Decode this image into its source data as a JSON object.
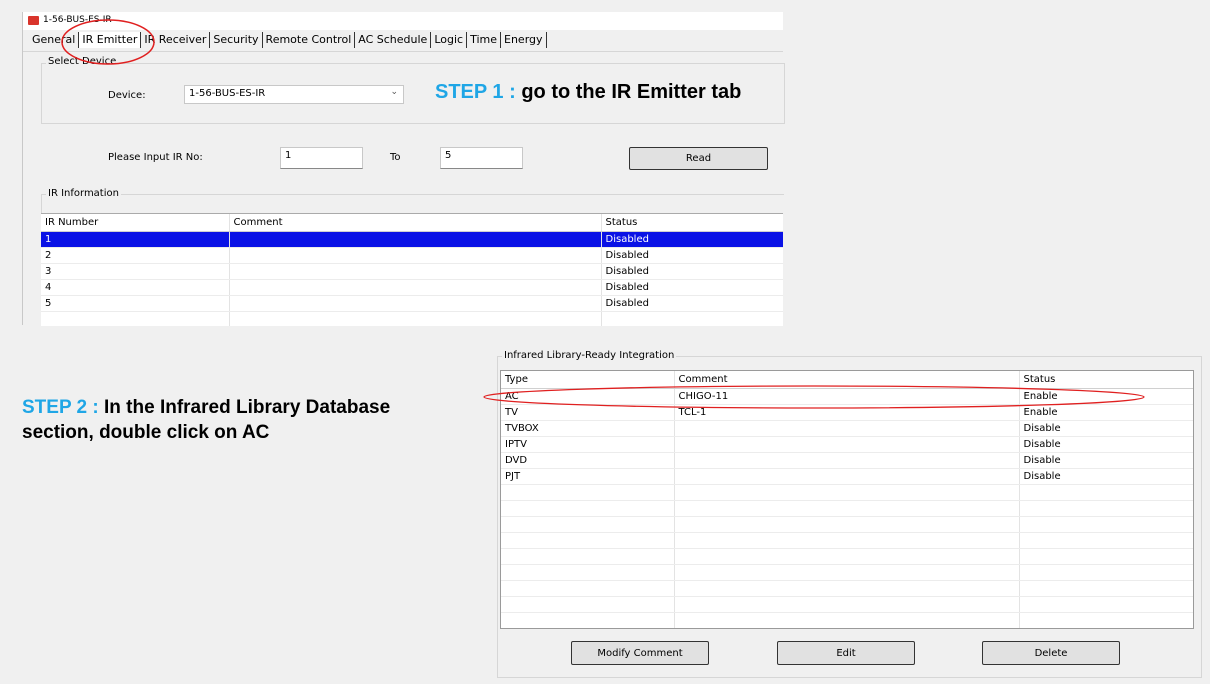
{
  "window": {
    "title": "1-56-BUS-ES-IR",
    "tabs": [
      "General",
      "IR Emitter",
      "IR Receiver",
      "Security",
      "Remote Control",
      "AC Schedule",
      "Logic",
      "Time",
      "Energy"
    ],
    "active_tab": "IR Emitter"
  },
  "select_device": {
    "group_label": "Select Device",
    "device_label": "Device:",
    "device_value": "1-56-BUS-ES-IR"
  },
  "ir_input": {
    "label": "Please Input IR No:",
    "from_value": "1",
    "to_label": "To",
    "to_value": "5",
    "read_button": "Read"
  },
  "ir_information": {
    "group_label": "IR Information",
    "columns": [
      "IR Number",
      "Comment",
      "Status"
    ],
    "rows": [
      {
        "number": "1",
        "comment": "",
        "status": "Disabled"
      },
      {
        "number": "2",
        "comment": "",
        "status": "Disabled"
      },
      {
        "number": "3",
        "comment": "",
        "status": "Disabled"
      },
      {
        "number": "4",
        "comment": "",
        "status": "Disabled"
      },
      {
        "number": "5",
        "comment": "",
        "status": "Disabled"
      }
    ]
  },
  "step1": {
    "prefix": "STEP 1 :",
    "text": " go to the IR Emitter tab"
  },
  "step2": {
    "prefix": "STEP 2 :",
    "text_line1": " In the Infrared Library Database",
    "text_line2": "section, double click on AC"
  },
  "library": {
    "group_label": "Infrared Library-Ready Integration",
    "columns": [
      "Type",
      "Comment",
      "Status"
    ],
    "rows": [
      {
        "type": "AC",
        "comment": "CHIGO-11",
        "status": "Enable"
      },
      {
        "type": "TV",
        "comment": "TCL-1",
        "status": "Enable"
      },
      {
        "type": "TVBOX",
        "comment": "",
        "status": "Disable"
      },
      {
        "type": "IPTV",
        "comment": "",
        "status": "Disable"
      },
      {
        "type": "DVD",
        "comment": "",
        "status": "Disable"
      },
      {
        "type": "PJT",
        "comment": "",
        "status": "Disable"
      }
    ],
    "buttons": {
      "modify": "Modify Comment",
      "edit": "Edit",
      "delete": "Delete"
    }
  },
  "colors": {
    "accent": "#1fa6e6",
    "selection": "#0a12e6",
    "annotation": "#e02020"
  },
  "icons": [
    "app-logo-icon",
    "chevron-down-icon"
  ]
}
